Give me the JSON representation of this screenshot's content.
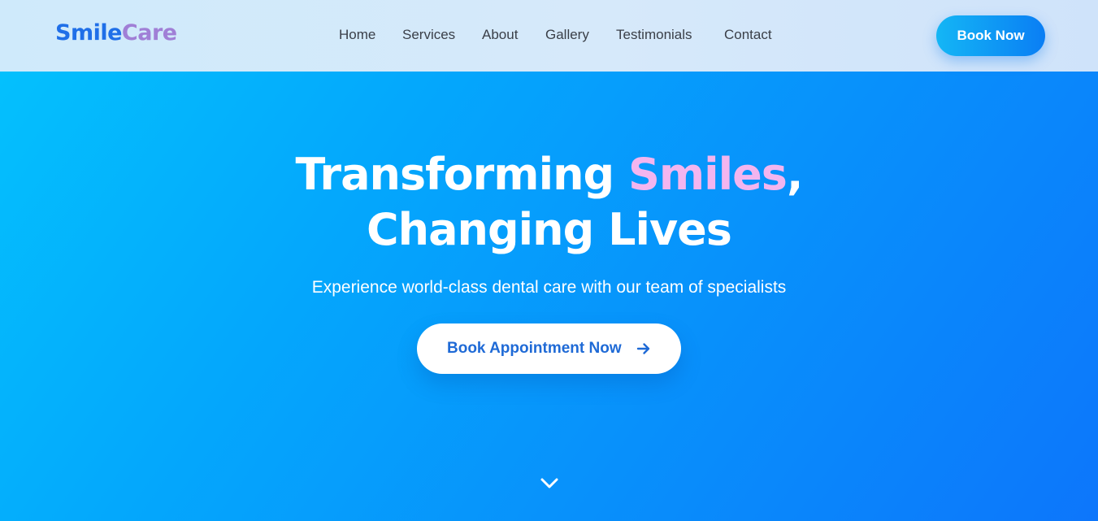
{
  "header": {
    "logo_primary": "Smile",
    "logo_secondary": "Care",
    "nav": [
      {
        "label": "Home"
      },
      {
        "label": "Services"
      },
      {
        "label": "About"
      },
      {
        "label": "Gallery"
      },
      {
        "label": "Testimonials"
      },
      {
        "label": "Contact"
      }
    ],
    "book_button_label": "Book Now"
  },
  "hero": {
    "headline_line1_start": "Transforming ",
    "headline_line1_accent": "Smiles",
    "headline_line1_end": ",",
    "headline_line2": "Changing Lives",
    "subtitle": "Experience world-class dental care with our team of specialists",
    "cta_label": "Book Appointment Now",
    "cta_icon": "arrow-right-icon",
    "scroll_icon": "chevron-down-icon"
  },
  "colors": {
    "brand_blue": "#1f6fe8",
    "brand_purple": "#a07fd6",
    "accent_pink": "#f3b5ef",
    "hero_gradient_start": "#04c0fd",
    "hero_gradient_end": "#0d76fb"
  }
}
